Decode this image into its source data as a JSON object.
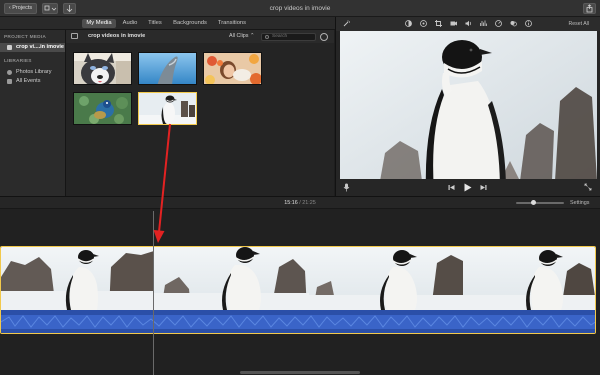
{
  "window": {
    "title": "crop videos in imovie",
    "projects_label": "Projects"
  },
  "tabs": [
    {
      "label": "My Media",
      "active": true
    },
    {
      "label": "Audio",
      "active": false
    },
    {
      "label": "Titles",
      "active": false
    },
    {
      "label": "Backgrounds",
      "active": false
    },
    {
      "label": "Transitions",
      "active": false
    }
  ],
  "sidebar": {
    "project_media_header": "PROJECT MEDIA",
    "project_item": "crop vi....in imovie",
    "libraries_header": "LIBRARIES",
    "library_items": [
      "Photos Library",
      "All Events"
    ]
  },
  "browser": {
    "title": "crop videos in imovie",
    "filter": "All Clips",
    "search_placeholder": "Search",
    "thumbnails": [
      {
        "subject": "husky dog",
        "selected": false
      },
      {
        "subject": "dolphin",
        "selected": false
      },
      {
        "subject": "girl in flowers",
        "selected": false
      },
      {
        "subject": "peacock",
        "selected": false
      },
      {
        "subject": "penguin",
        "selected": true
      }
    ]
  },
  "viewer": {
    "reset_all": "Reset All"
  },
  "timeline": {
    "current_time": "15:16",
    "separator": "/",
    "duration": "21:25",
    "settings": "Settings",
    "zoom_level": 0.35
  },
  "colors": {
    "selection": "#f2c94c",
    "annotation_arrow": "#e32222",
    "audio_wave": "#3a64c8"
  }
}
